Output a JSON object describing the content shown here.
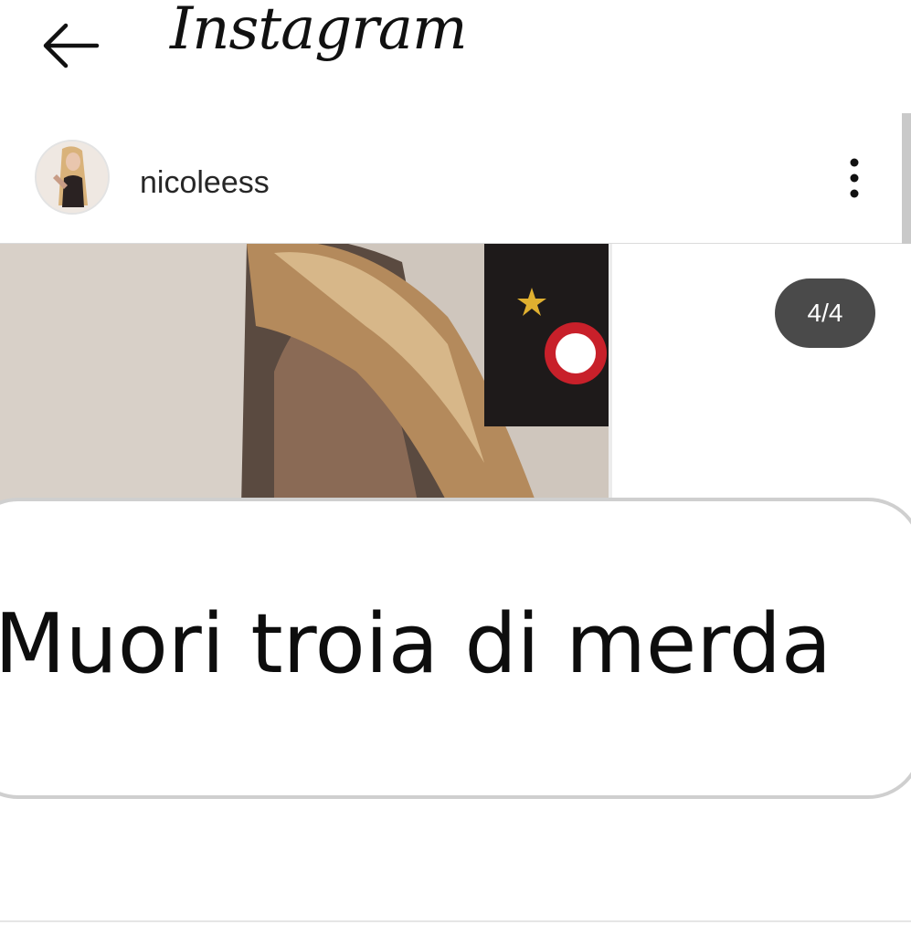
{
  "app": {
    "title": "Instagram"
  },
  "icons": {
    "back": "back-arrow-icon",
    "more": "more-vertical-icon"
  },
  "post": {
    "username": "nicoleess",
    "slide_counter": "4/4",
    "current_slide": 4,
    "total_slides": 4,
    "message_text": "Muori troia di merda"
  },
  "colors": {
    "counter_bg": "#4a4a4a",
    "counter_text": "#ffffff",
    "bubble_border": "#cfcfcf"
  }
}
